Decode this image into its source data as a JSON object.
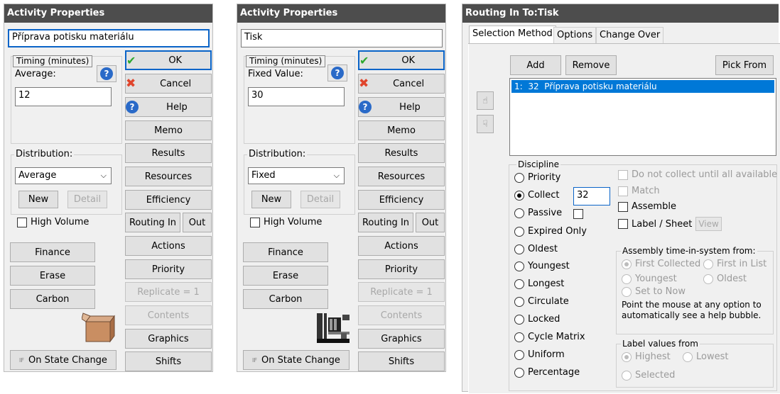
{
  "dialog1": {
    "title": "Activity Properties",
    "name_value": "Příprava potisku materiálu",
    "timing_label": "Timing (minutes)",
    "field_label": "Average:",
    "field_value": "12",
    "distribution_label": "Distribution:",
    "distribution_value": "Average",
    "new_label": "New",
    "detail_label": "Detail",
    "high_volume_label": "High Volume",
    "finance_label": "Finance",
    "erase_label": "Erase",
    "carbon_label": "Carbon",
    "on_state_prefix": "IF",
    "on_state_label": "On State Change",
    "graphic_icon": "box-icon"
  },
  "dialog2": {
    "title": "Activity Properties",
    "name_value": "Tisk",
    "timing_label": "Timing (minutes)",
    "field_label": "Fixed Value:",
    "field_value": "30",
    "distribution_label": "Distribution:",
    "distribution_value": "Fixed",
    "new_label": "New",
    "detail_label": "Detail",
    "high_volume_label": "High Volume",
    "finance_label": "Finance",
    "erase_label": "Erase",
    "carbon_label": "Carbon",
    "on_state_prefix": "IF",
    "on_state_label": "On State Change",
    "graphic_icon": "printer-machine-icon"
  },
  "buttons": {
    "ok": "OK",
    "cancel": "Cancel",
    "help": "Help",
    "memo": "Memo",
    "results": "Results",
    "resources": "Resources",
    "efficiency": "Efficiency",
    "routing_in": "Routing In",
    "out": "Out",
    "actions": "Actions",
    "priority": "Priority",
    "replicate": "Replicate = 1",
    "contents": "Contents",
    "graphics": "Graphics",
    "shifts": "Shifts"
  },
  "routing": {
    "title": "Routing In To:Tisk",
    "tabs": [
      "Selection Method",
      "Options",
      "Change Over"
    ],
    "add": "Add",
    "remove": "Remove",
    "pick_from": "Pick From",
    "list_items": [
      {
        "num": "1:",
        "qty": "32",
        "name": "Příprava potisku materiálu"
      }
    ],
    "discipline_label": "Discipline",
    "options": [
      "Priority",
      "Collect",
      "Passive",
      "Expired Only",
      "Oldest",
      "Youngest",
      "Longest",
      "Circulate",
      "Locked",
      "Cycle Matrix",
      "Uniform",
      "Percentage"
    ],
    "selected_option": "Collect",
    "collect_value": "32",
    "do_not_collect": "Do not collect until all available",
    "match": "Match",
    "assemble": "Assemble",
    "label_sheet": "Label / Sheet",
    "view": "View",
    "assembly_label": "Assembly time-in-system from:",
    "first_collected": "First Collected",
    "first_in_list": "First in List",
    "youngest": "Youngest",
    "oldest": "Oldest",
    "set_to_now": "Set to Now",
    "help_text": "Point the mouse at any option to automatically see a help bubble.",
    "label_values_label": "Label values from",
    "highest": "Highest",
    "lowest": "Lowest",
    "selected": "Selected"
  }
}
